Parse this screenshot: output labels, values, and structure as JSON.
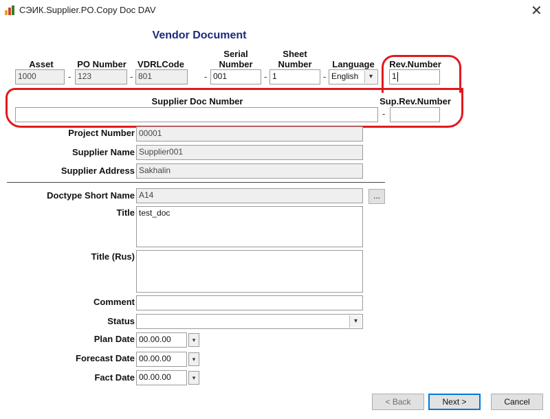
{
  "window": {
    "title": "СЭИК.Supplier.PO.Copy Doc  DAV",
    "close": "✕"
  },
  "heading": "Vendor Document",
  "top_row": {
    "asset": {
      "label": "Asset",
      "value": "1000"
    },
    "po_number": {
      "label": "PO Number",
      "value": "123"
    },
    "vdrl_code": {
      "label": "VDRLCode",
      "value": "801"
    },
    "serial_number": {
      "label_1": "Serial",
      "label_2": "Number",
      "value": "001"
    },
    "sheet_number": {
      "label_1": "Sheet",
      "label_2": "Number",
      "value": "1"
    },
    "language": {
      "label": "Language",
      "value": "English"
    },
    "rev_number": {
      "label": "Rev.Number",
      "value": "1"
    },
    "dash": "-"
  },
  "supplier_doc": {
    "label": "Supplier Doc Number",
    "value": "",
    "sup_rev_label": "Sup.Rev.Number",
    "sup_rev_value": ""
  },
  "project": {
    "project_number": {
      "label": "Project Number",
      "value": "00001"
    },
    "supplier_name": {
      "label": "Supplier Name",
      "value": "Supplier001"
    },
    "supplier_address": {
      "label": "Supplier Address",
      "value": "Sakhalin"
    }
  },
  "document": {
    "doctype_short_name": {
      "label": "Doctype Short Name",
      "value": "A14",
      "browse": "..."
    },
    "title": {
      "label": "Title",
      "value": "test_doc"
    },
    "title_rus": {
      "label": "Title (Rus)",
      "value": ""
    },
    "comment": {
      "label": "Comment",
      "value": ""
    },
    "status": {
      "label": "Status",
      "value": ""
    },
    "plan_date": {
      "label": "Plan Date",
      "value": "00.00.00"
    },
    "forecast_date": {
      "label": "Forecast Date",
      "value": "00.00.00"
    },
    "fact_date": {
      "label": "Fact Date",
      "value": "00.00.00"
    }
  },
  "buttons": {
    "back": "< Back",
    "next": "Next >",
    "cancel": "Cancel"
  },
  "colors": {
    "highlight": "#e0191e",
    "heading": "#1a2a7a",
    "focus": "#0078d7"
  }
}
